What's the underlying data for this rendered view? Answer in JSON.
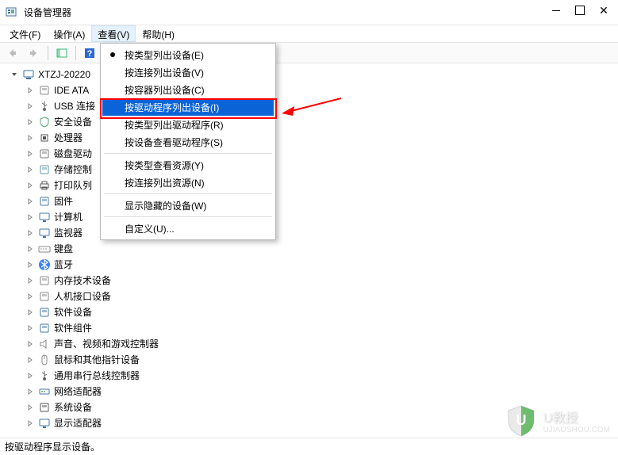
{
  "window": {
    "title": "设备管理器",
    "controls": {
      "close": "✕"
    }
  },
  "menubar": {
    "items": [
      {
        "label": "文件(F)"
      },
      {
        "label": "操作(A)"
      },
      {
        "label": "查看(V)",
        "open": true
      },
      {
        "label": "帮助(H)"
      }
    ]
  },
  "dropdown": {
    "items": [
      {
        "label": "按类型列出设备(E)",
        "checked": true
      },
      {
        "label": "按连接列出设备(V)"
      },
      {
        "label": "按容器列出设备(C)"
      },
      {
        "label": "按驱动程序列出设备(I)",
        "selected": true
      },
      {
        "label": "按类型列出驱动程序(R)"
      },
      {
        "label": "按设备查看驱动程序(S)"
      },
      {
        "type": "sep"
      },
      {
        "label": "按类型查看资源(Y)"
      },
      {
        "label": "按连接列出资源(N)"
      },
      {
        "type": "sep"
      },
      {
        "label": "显示隐藏的设备(W)"
      },
      {
        "type": "sep"
      },
      {
        "label": "自定义(U)..."
      }
    ]
  },
  "tree": {
    "root": "XTZJ-20220",
    "nodes": [
      {
        "label": "IDE ATA",
        "icon": "drive"
      },
      {
        "label": "USB 连接",
        "icon": "usb"
      },
      {
        "label": "安全设备",
        "icon": "shield"
      },
      {
        "label": "处理器",
        "icon": "cpu"
      },
      {
        "label": "磁盘驱动",
        "icon": "disk"
      },
      {
        "label": "存储控制",
        "icon": "storage"
      },
      {
        "label": "打印队列",
        "icon": "printer"
      },
      {
        "label": "固件",
        "icon": "firmware"
      },
      {
        "label": "计算机",
        "icon": "computer"
      },
      {
        "label": "监视器",
        "icon": "monitor"
      },
      {
        "label": "键盘",
        "icon": "keyboard"
      },
      {
        "label": "蓝牙",
        "icon": "bluetooth"
      },
      {
        "label": "内存技术设备",
        "icon": "memory"
      },
      {
        "label": "人机接口设备",
        "icon": "hid"
      },
      {
        "label": "软件设备",
        "icon": "software"
      },
      {
        "label": "软件组件",
        "icon": "component"
      },
      {
        "label": "声音、视频和游戏控制器",
        "icon": "sound"
      },
      {
        "label": "鼠标和其他指针设备",
        "icon": "mouse"
      },
      {
        "label": "通用串行总线控制器",
        "icon": "usbctrl"
      },
      {
        "label": "网络适配器",
        "icon": "network"
      },
      {
        "label": "系统设备",
        "icon": "system"
      },
      {
        "label": "显示适配器",
        "icon": "display"
      }
    ]
  },
  "statusbar": {
    "text": "按驱动程序显示设备。"
  },
  "watermark": {
    "brand": "U教授",
    "url": "UJIAOSHOU.COM"
  },
  "icons": {
    "drive": "#888",
    "usb": "#666",
    "shield": "#5a7",
    "cpu": "#555",
    "disk": "#777",
    "storage": "#69a",
    "printer": "#555",
    "firmware": "#47a",
    "computer": "#47a",
    "monitor": "#47a",
    "keyboard": "#888",
    "bluetooth": "#3b82f6",
    "memory": "#888",
    "hid": "#888",
    "software": "#47a",
    "component": "#47a",
    "sound": "#888",
    "mouse": "#888",
    "usbctrl": "#666",
    "network": "#47a",
    "system": "#555",
    "display": "#47a"
  }
}
